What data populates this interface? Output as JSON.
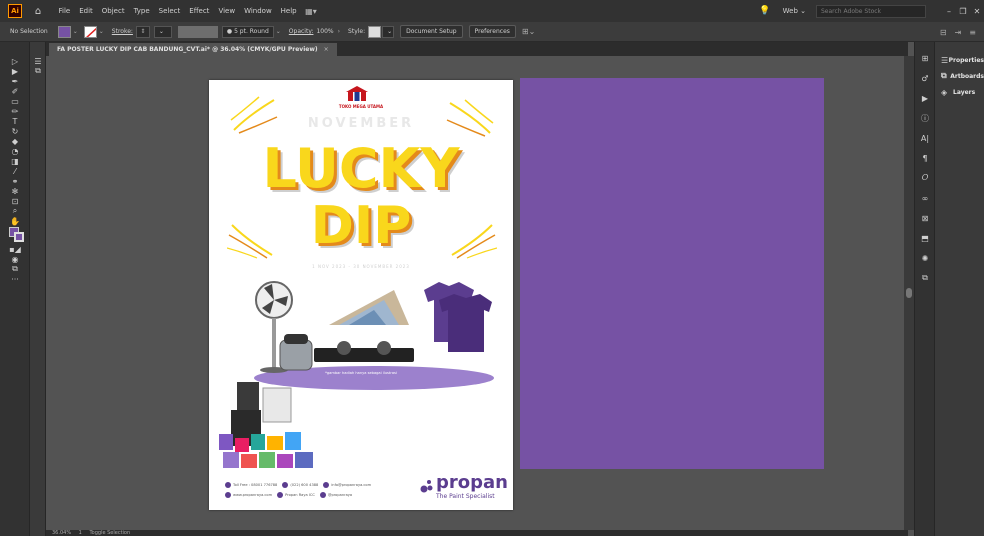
{
  "app": {
    "logo_text": "Ai"
  },
  "menu": [
    "File",
    "Edit",
    "Object",
    "Type",
    "Select",
    "Effect",
    "View",
    "Window",
    "Help"
  ],
  "topright": {
    "workspace": "Web",
    "search_placeholder": "Search Adobe Stock"
  },
  "control": {
    "selection": "No Selection",
    "stroke_label": "Stroke:",
    "brush": "5 pt. Round",
    "opacity_label": "Opacity:",
    "opacity_value": "100%",
    "style_label": "Style:",
    "doc_setup": "Document Setup",
    "preferences": "Preferences"
  },
  "document_tab": {
    "title": "FA POSTER LUCKY DIP CAB BANDUNG_CVT.ai* @ 36.04% (CMYK/GPU Preview)",
    "close": "×"
  },
  "panels": [
    {
      "icon": "properties-icon",
      "label": "Properties"
    },
    {
      "icon": "artboards-icon",
      "label": "Artboards"
    },
    {
      "icon": "layers-icon",
      "label": "Layers"
    }
  ],
  "status": {
    "zoom": "36.04%",
    "artboard": "1",
    "tool": "Toggle Selection"
  },
  "poster": {
    "brand_name": "TOKO MEGA UTAMA",
    "month": "NOVEMBER",
    "title_line1": "LUCKY",
    "title_line2": "DIP",
    "dates": "1 NOV 2023 - 30 NOVEMBER 2023",
    "caption": "*gambar hadiah hanya sebagai ilustrasi",
    "contacts": [
      {
        "icon": "phone-icon",
        "text": "Toll Free : 08001 776788"
      },
      {
        "icon": "phone-icon",
        "text": "(022) 600 4388"
      },
      {
        "icon": "mail-icon",
        "text": "info@propanraya.com"
      },
      {
        "icon": "web-icon",
        "text": "www.propanraya.com"
      },
      {
        "icon": "facebook-icon",
        "text": "Propan Raya ICC"
      },
      {
        "icon": "social-icon",
        "text": "@propanraya"
      }
    ],
    "propan_name": "propan",
    "propan_tagline": "The Paint Specialist"
  },
  "colors": {
    "artboard_fill": "#7652a4",
    "yellow": "#f9d71c",
    "orange": "#e48a1b",
    "brand_purple": "#5b3d8f"
  }
}
